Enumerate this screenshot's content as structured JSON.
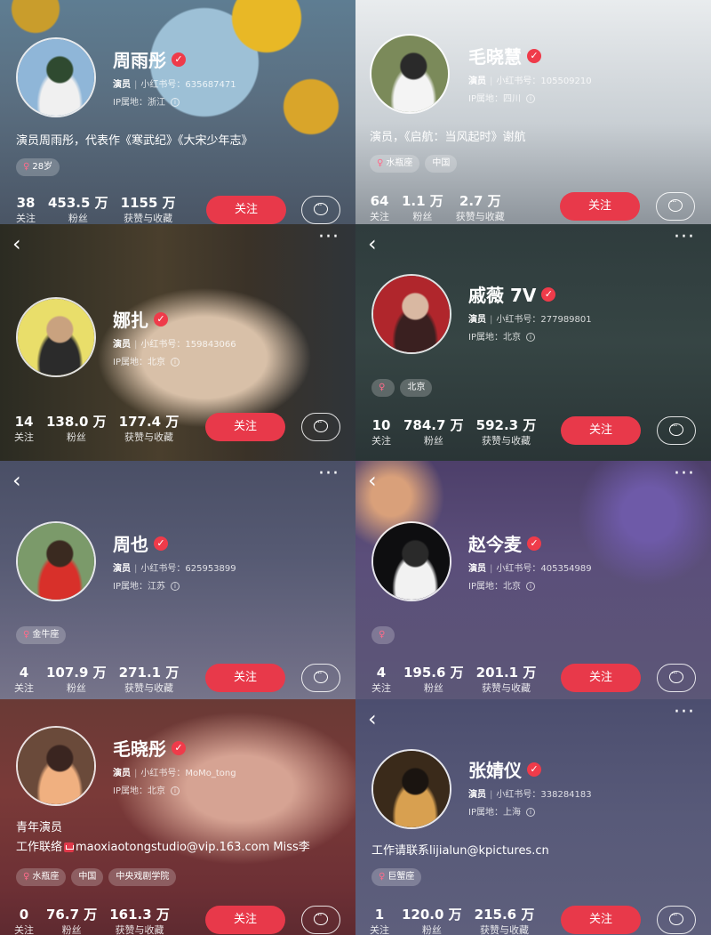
{
  "ui": {
    "follow_label": "关注",
    "back_glyph": "‹",
    "more_glyph": "···",
    "verified_glyph": "✓",
    "info_glyph": "i",
    "id_prefix": "小红书号：",
    "ip_prefix": "IP属地：",
    "female_symbol": "♀",
    "stat_labels": {
      "following": "关注",
      "fans": "粉丝",
      "likes": "获赞与收藏"
    }
  },
  "profiles": [
    {
      "name": "周雨彤",
      "role": "演员",
      "id": "635687471",
      "ip": "浙江",
      "bio": [
        "演员周雨彤，代表作《寒武纪》《大宋少年志》"
      ],
      "gender_tag": "28岁",
      "tags": [],
      "stats": {
        "following": "38",
        "fans": "453.5 万",
        "likes": "1155 万"
      },
      "avatar_colors": [
        "#8fb6d8",
        "#f0f0f0",
        "#2f4a30"
      ]
    },
    {
      "name": "毛晓慧",
      "role": "演员",
      "id": "105509210",
      "ip": "四川",
      "bio": [
        "演员，《启航：当风起时》谢航"
      ],
      "gender_tag": "水瓶座",
      "tags": [
        "中国"
      ],
      "stats": {
        "following": "64",
        "fans": "1.1 万",
        "likes": "2.7 万"
      },
      "avatar_colors": [
        "#7b8a5a",
        "#f4f4f4",
        "#2a2a2a"
      ]
    },
    {
      "name": "娜扎",
      "role": "演员",
      "id": "159843066",
      "ip": "北京",
      "bio": [],
      "gender_tag": "",
      "tags": [],
      "stats": {
        "following": "14",
        "fans": "138.0 万",
        "likes": "177.4 万"
      },
      "avatar_colors": [
        "#e9de6a",
        "#2b2b2b",
        "#c9a27f"
      ]
    },
    {
      "name": "戚薇 7V",
      "role": "演员",
      "id": "277989801",
      "ip": "北京",
      "bio": [],
      "gender_tag": "",
      "tags": [
        "北京"
      ],
      "stats": {
        "following": "10",
        "fans": "784.7 万",
        "likes": "592.3 万"
      },
      "avatar_colors": [
        "#b0262c",
        "#3a2020",
        "#d9b8a2"
      ]
    },
    {
      "name": "周也",
      "role": "演员",
      "id": "625953899",
      "ip": "江苏",
      "bio": [],
      "gender_tag": "金牛座",
      "tags": [],
      "stats": {
        "following": "4",
        "fans": "107.9 万",
        "likes": "271.1 万"
      },
      "avatar_colors": [
        "#7b9a6a",
        "#d8302a",
        "#3a2a20"
      ]
    },
    {
      "name": "赵今麦",
      "role": "演员",
      "id": "405354989",
      "ip": "北京",
      "bio": [],
      "gender_tag": "",
      "tags": [],
      "stats": {
        "following": "4",
        "fans": "195.6 万",
        "likes": "201.1 万"
      },
      "avatar_colors": [
        "#0e0e10",
        "#f2f2f2",
        "#2a2a2a"
      ]
    },
    {
      "name": "毛晓彤",
      "role": "演员",
      "id": "MoMo_tong",
      "ip": "北京",
      "bio": [
        "青年演员",
        "工作联络",
        "maoxiaotongstudio@vip.163.com Miss李"
      ],
      "gender_tag": "水瓶座",
      "tags": [
        "中国",
        "中央戏剧学院"
      ],
      "stats": {
        "following": "0",
        "fans": "76.7 万",
        "likes": "161.3 万"
      },
      "avatar_colors": [
        "#6a4a3a",
        "#f0b080",
        "#3a2520"
      ]
    },
    {
      "name": "张婧仪",
      "role": "演员",
      "id": "338284183",
      "ip": "上海",
      "bio": [
        "工作请联系lijialun@kpictures.cn"
      ],
      "gender_tag": "巨蟹座",
      "tags": [],
      "stats": {
        "following": "1",
        "fans": "120.0 万",
        "likes": "215.6 万"
      },
      "avatar_colors": [
        "#3a2a1a",
        "#d8a050",
        "#1a1410"
      ]
    }
  ]
}
